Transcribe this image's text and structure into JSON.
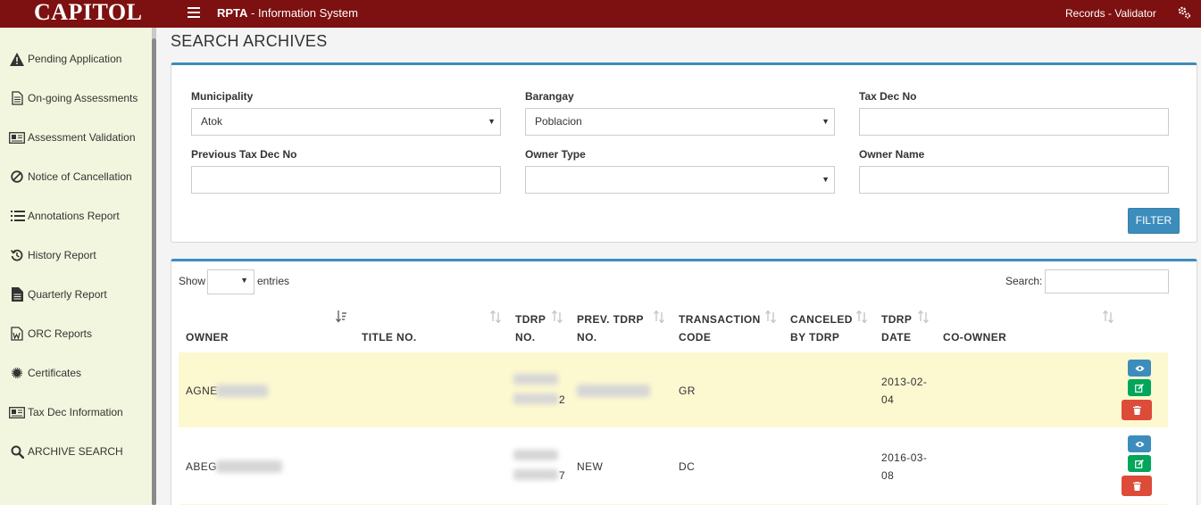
{
  "topbar": {
    "brand": "CAPITOL",
    "system_bold": "RPTA",
    "system_rest": " - Information System",
    "user": "Records - Validator"
  },
  "sidebar": {
    "items": [
      {
        "label": "Pending Application",
        "icon": "warning-icon"
      },
      {
        "label": "On-going Assessments",
        "icon": "document-icon"
      },
      {
        "label": "Assessment Validation",
        "icon": "id-card-icon"
      },
      {
        "label": "Notice of Cancellation",
        "icon": "ban-icon"
      },
      {
        "label": "Annotations Report",
        "icon": "list-icon"
      },
      {
        "label": "History Report",
        "icon": "history-icon"
      },
      {
        "label": "Quarterly Report",
        "icon": "file-icon"
      },
      {
        "label": "ORC Reports",
        "icon": "word-file-icon"
      },
      {
        "label": "Certificates",
        "icon": "certificate-icon"
      },
      {
        "label": "Tax Dec Information",
        "icon": "id-card-icon"
      },
      {
        "label": "ARCHIVE SEARCH",
        "icon": "search-icon"
      }
    ]
  },
  "page": {
    "title": "SEARCH ARCHIVES"
  },
  "filters": {
    "municipality_label": "Municipality",
    "municipality_value": "Atok",
    "barangay_label": "Barangay",
    "barangay_value": "Poblacion",
    "tax_dec_label": "Tax Dec No",
    "tax_dec_value": "",
    "prev_tax_dec_label": "Previous Tax Dec No",
    "prev_tax_dec_value": "",
    "owner_type_label": "Owner Type",
    "owner_type_value": "",
    "owner_name_label": "Owner Name",
    "owner_name_value": "",
    "filter_button": "FILTER"
  },
  "table_controls": {
    "show_label": "Show",
    "entries_value": "",
    "entries_label": "entries",
    "search_label": "Search:",
    "search_value": ""
  },
  "table": {
    "headers": {
      "owner": "OWNER",
      "title_no": "TITLE NO.",
      "tdrp_no_1": "TDRP",
      "tdrp_no_2": "NO.",
      "prev_tdrp_1": "PREV. TDRP",
      "prev_tdrp_2": "NO.",
      "transaction_1": "TRANSACTION",
      "transaction_2": "CODE",
      "canceled_1": "CANCELED",
      "canceled_2": "BY TDRP",
      "tdrp_date_1": "TDRP",
      "tdrp_date_2": "DATE",
      "co_owner": "CO-OWNER"
    },
    "rows": [
      {
        "owner": "AGNE",
        "title_no": "",
        "tdrp_no_tail": "2",
        "prev_tdrp": "",
        "transaction_code": "GR",
        "canceled_by": "",
        "tdrp_date_1": "2013-02-",
        "tdrp_date_2": "04",
        "co_owner": ""
      },
      {
        "owner": "ABEG",
        "title_no": "",
        "tdrp_no_tail": "7",
        "prev_tdrp": "NEW",
        "transaction_code": "DC",
        "canceled_by": "",
        "tdrp_date_1": "2016-03-",
        "tdrp_date_2": "08",
        "co_owner": ""
      }
    ]
  },
  "colors": {
    "topbar": "#7d1010",
    "sidebar": "#f3f6de",
    "primary": "#3c8dbc",
    "success": "#00a65a",
    "danger": "#dd4b39",
    "row_highlight": "#fcf8d0"
  }
}
